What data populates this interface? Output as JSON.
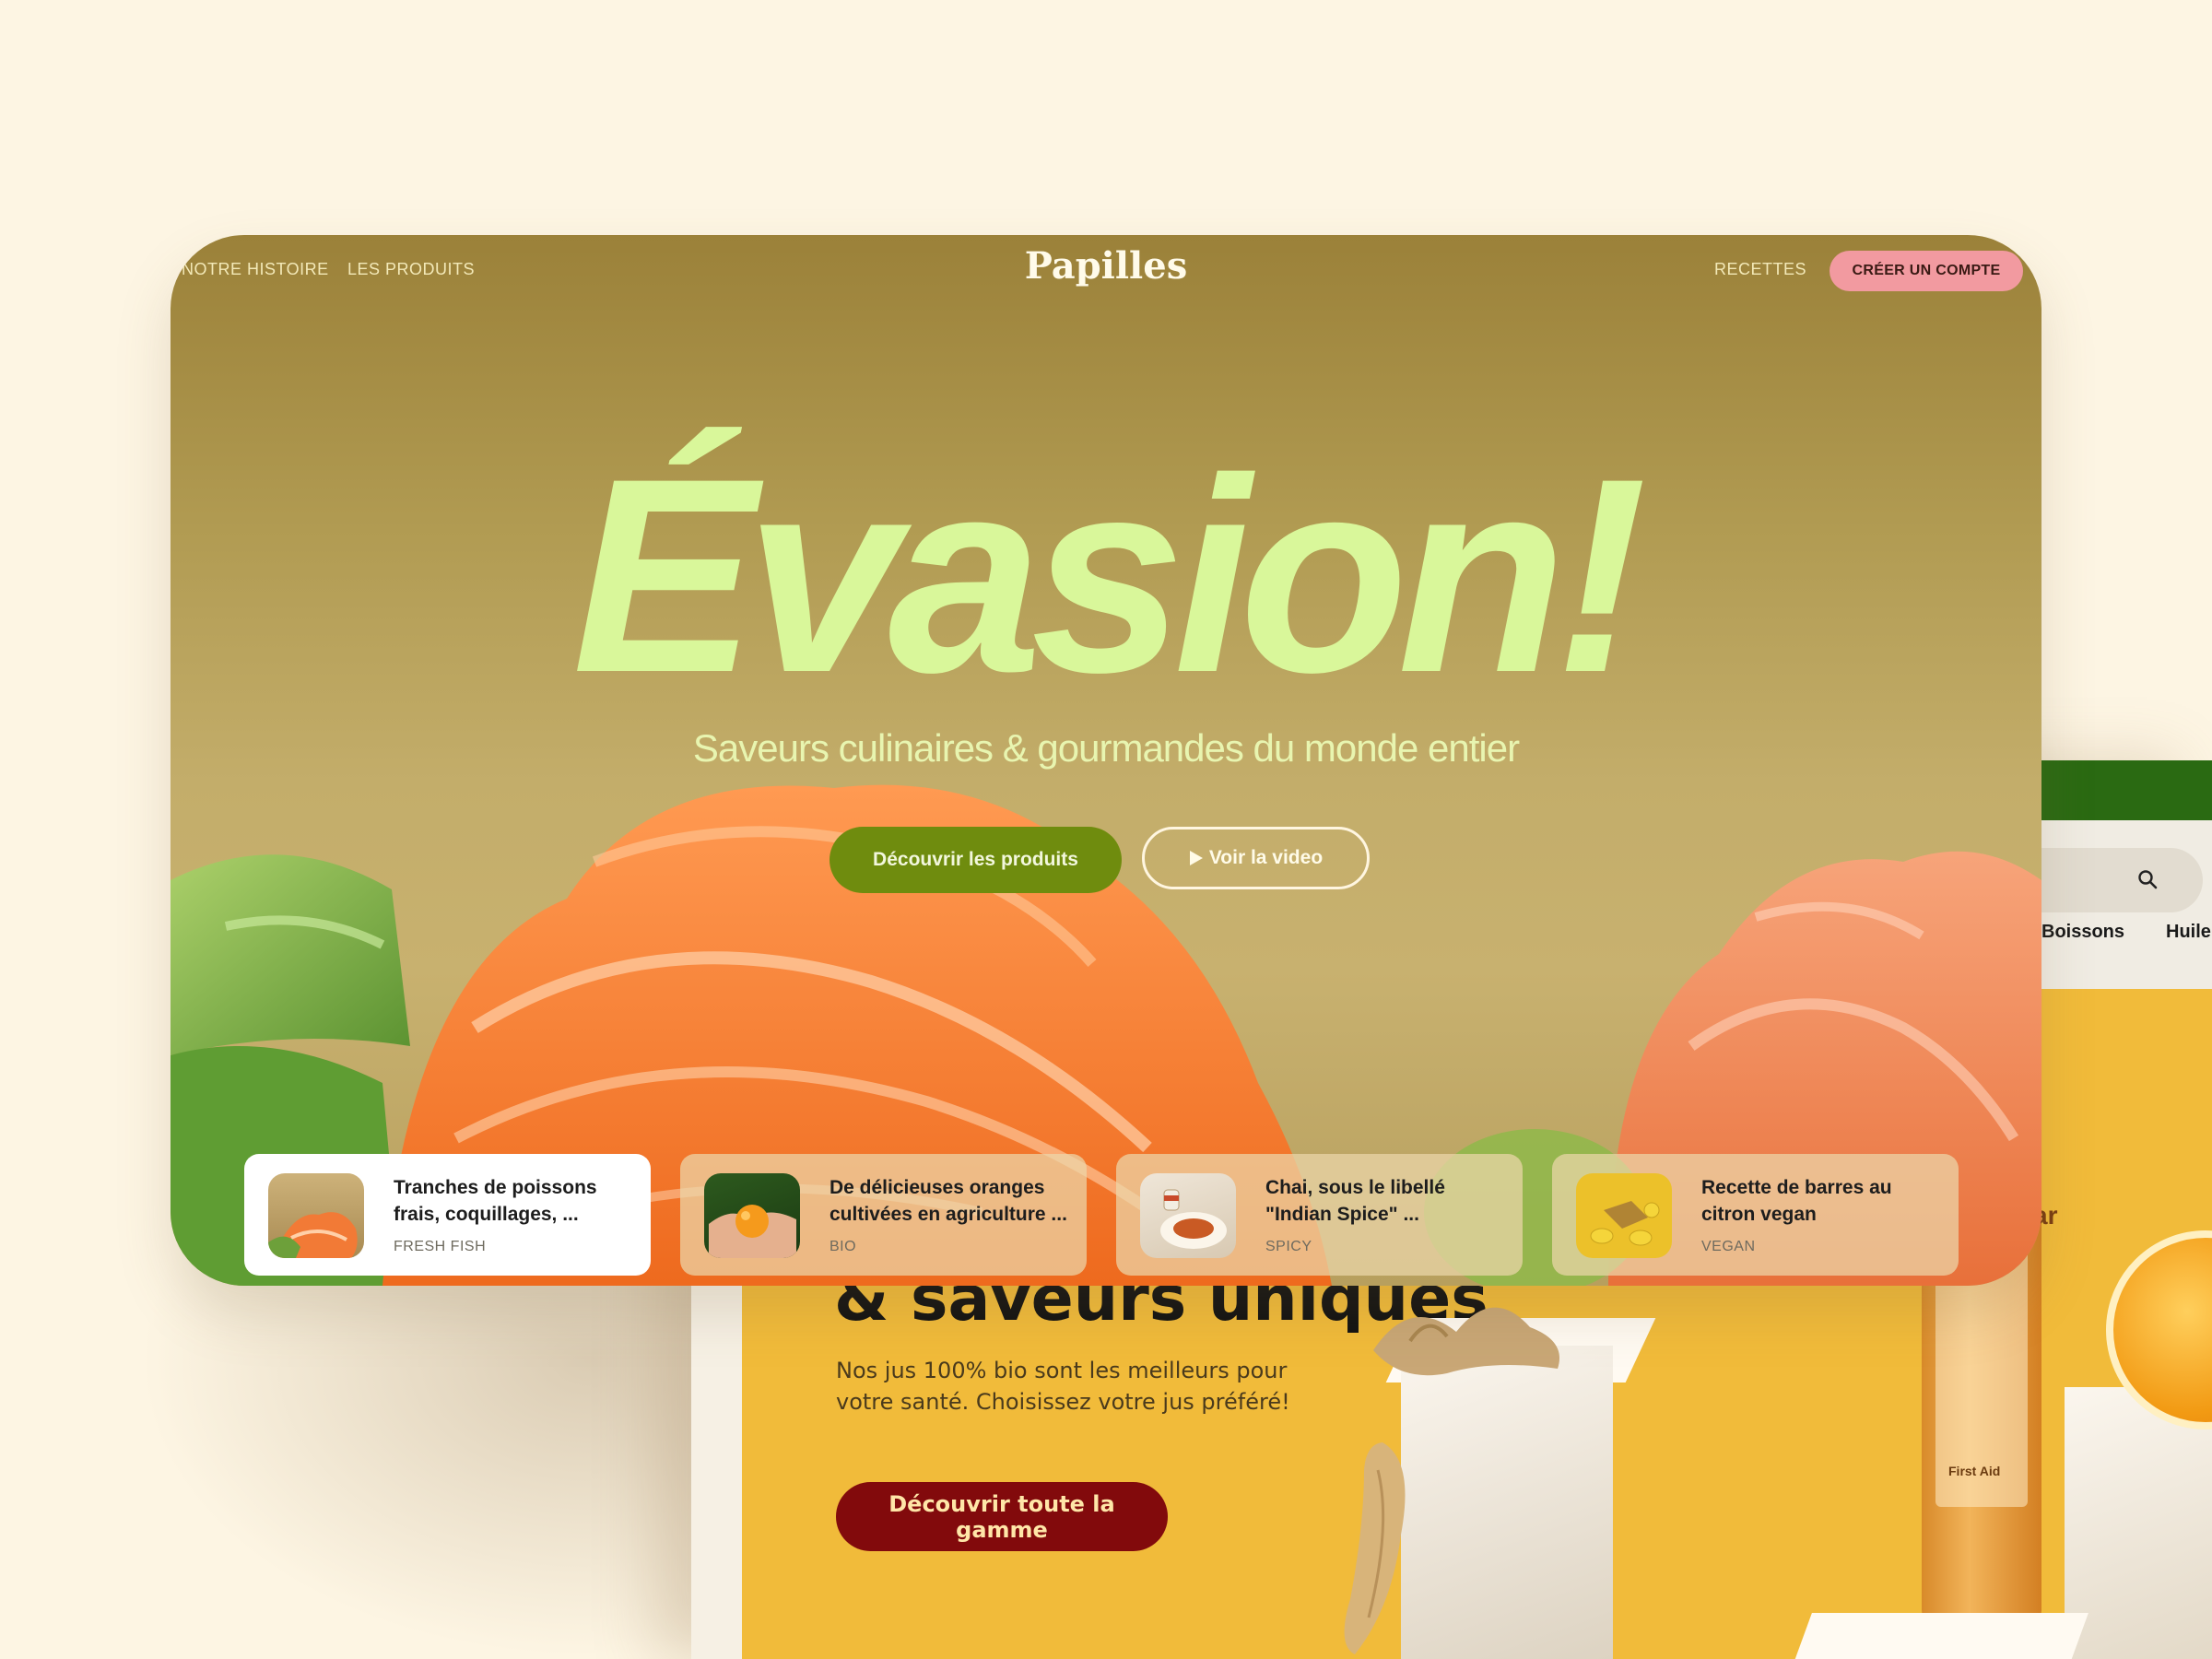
{
  "nav": {
    "left_links": [
      "NOTRE HISTOIRE",
      "LES PRODUITS"
    ],
    "logo": "Papilles",
    "right_link": "RECETTES",
    "account_button": "CRÉER UN COMPTE"
  },
  "hero": {
    "headline": "Évasion!",
    "subtitle": "Saveurs culinaires & gourmandes du monde entier",
    "primary_button": "Découvrir les produits",
    "secondary_button": "Voir la video"
  },
  "cards": [
    {
      "title": "Tranches de poissons frais, coquillages, ...",
      "tag": "FRESH FISH",
      "active": true
    },
    {
      "title": "De délicieuses oranges cultivées en agriculture ...",
      "tag": "BIO",
      "active": false
    },
    {
      "title": "Chai, sous le libellé \"Indian Spice\" ...",
      "tag": "SPICY",
      "active": false
    },
    {
      "title": "Recette de barres au citron vegan",
      "tag": "VEGAN",
      "active": false
    }
  ],
  "background_page": {
    "categories": [
      "Boissons",
      "Huile"
    ],
    "heading": "& saveurs uniques",
    "text": "Nos jus 100% bio sont les meilleurs pour votre santé. Choisissez votre jus préféré!",
    "cta": "Découvrir toute la gamme",
    "bottle_brand": "ar",
    "bottle_label": "First Aid"
  },
  "colors": {
    "page_bg": "#fdf5e3",
    "headline": "#d9f79a",
    "primary_button": "#6f8c0e",
    "account_button": "#f29aa0",
    "bg_page_yellow": "#f1bb3a",
    "bg_cta": "#820a0c",
    "bg_topbar_green": "#2a6a12"
  },
  "icons": [
    "search-icon",
    "play-icon"
  ]
}
